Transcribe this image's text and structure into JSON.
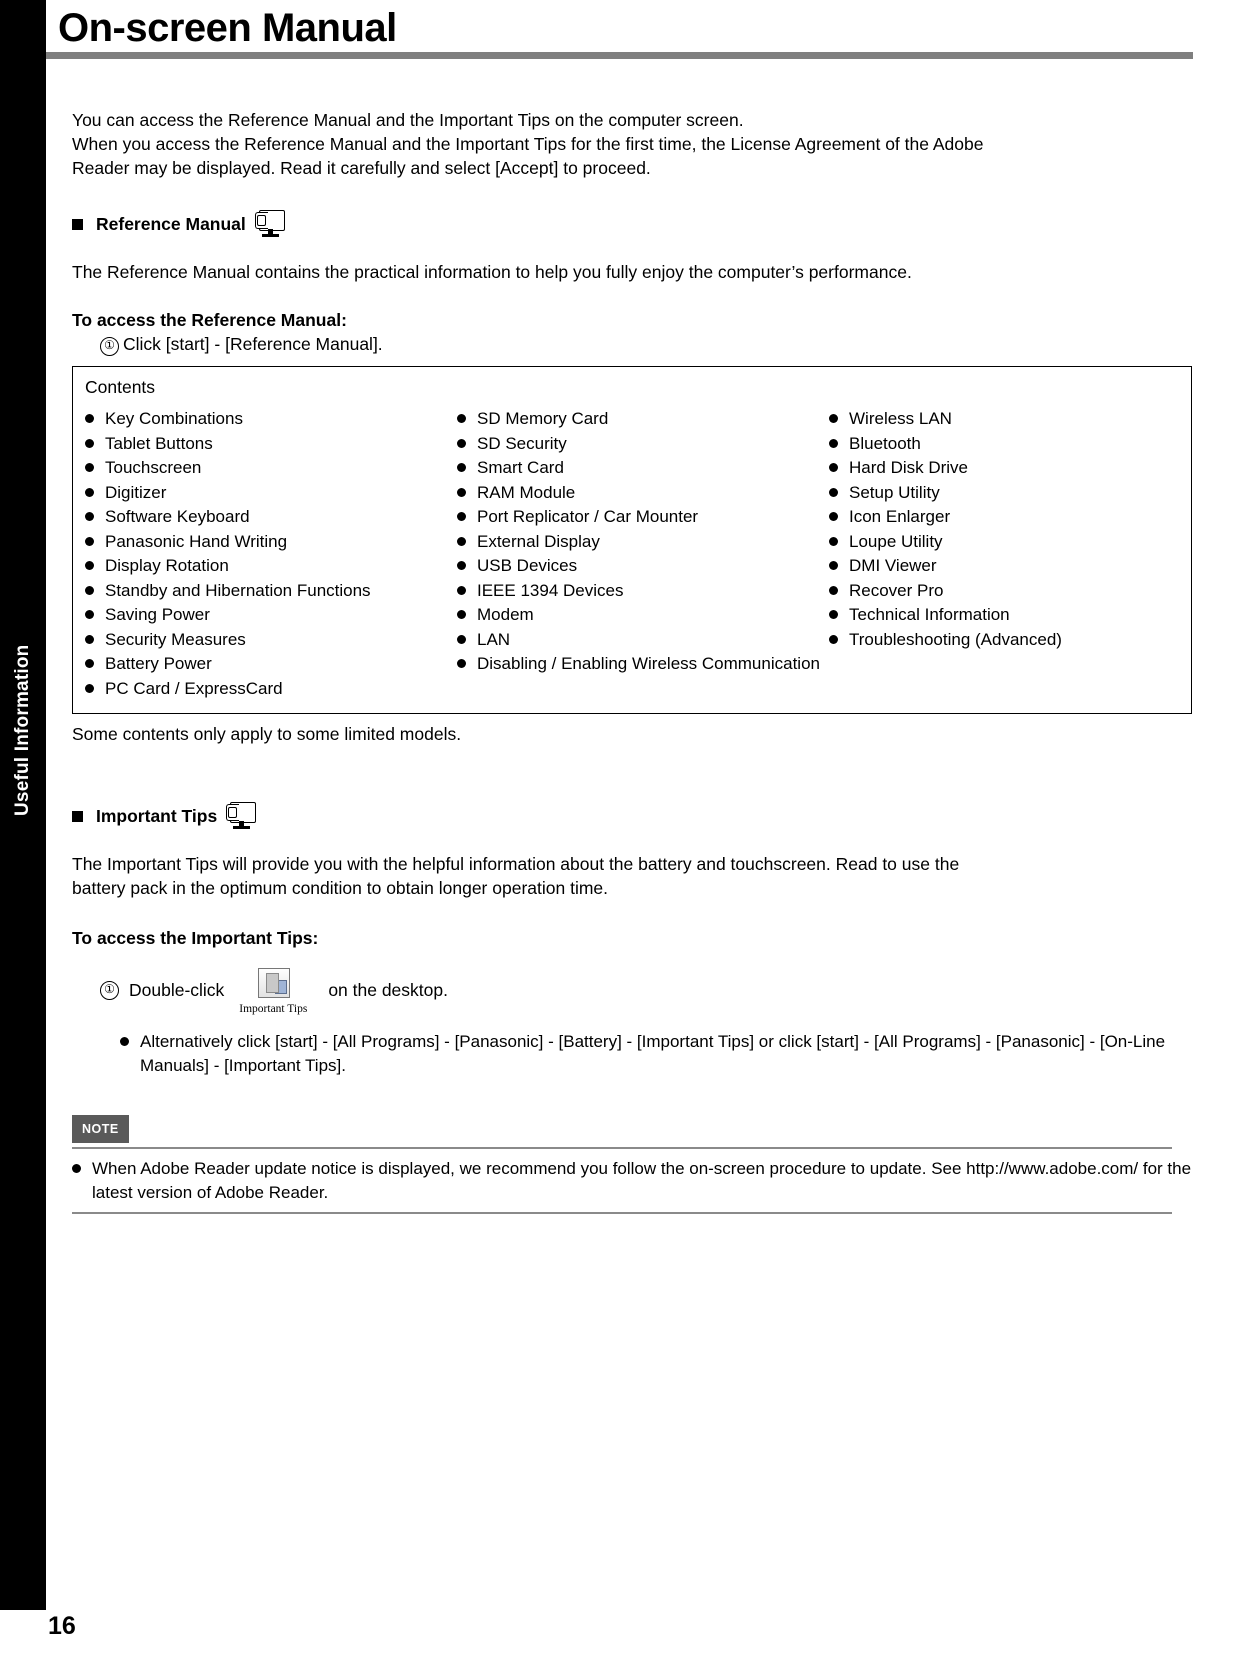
{
  "page": {
    "title": "On-screen Manual",
    "number": "16",
    "side_tab": "Useful Information"
  },
  "intro": {
    "line1": "You can access the Reference Manual and the Important Tips on the computer screen.",
    "line2": "When you access the Reference Manual and the Important Tips for the first time, the License Agreement of the Adobe",
    "line3": "Reader may be displayed. Read it carefully and select [Accept] to proceed."
  },
  "reference_manual": {
    "heading": "Reference Manual",
    "icon": "screen-with-pen-icon",
    "description": "The Reference Manual contains the practical information to help you fully enjoy the computer’s performance.",
    "access_heading": "To access the Reference Manual:",
    "step1_num": "①",
    "step1": "Click [start] - [Reference Manual].",
    "contents_label": "Contents",
    "contents_col1": [
      "Key Combinations",
      "Tablet Buttons",
      "Touchscreen",
      "Digitizer",
      "Software Keyboard",
      "Panasonic Hand Writing",
      "Display Rotation",
      "Standby and Hibernation Functions",
      "Saving Power",
      "Security Measures",
      "Battery Power",
      "PC Card / ExpressCard"
    ],
    "contents_col2": [
      "SD Memory Card",
      "SD Security",
      "Smart Card",
      "RAM Module",
      "Port Replicator / Car Mounter",
      "External Display",
      "USB Devices",
      "IEEE 1394 Devices",
      "Modem",
      "LAN",
      "Disabling / Enabling Wireless Communication"
    ],
    "contents_col3": [
      "Wireless LAN",
      "Bluetooth",
      "Hard Disk Drive",
      "Setup Utility",
      "Icon Enlarger",
      "Loupe Utility",
      "DMI Viewer",
      "Recover Pro",
      "Technical Information",
      "Troubleshooting (Advanced)"
    ],
    "footnote": "Some contents only apply to some limited models."
  },
  "important_tips": {
    "heading": "Important Tips",
    "icon": "screen-with-pen-icon",
    "description_line1": "The Important Tips will provide you with the helpful information about the battery and touchscreen. Read to use the",
    "description_line2": "battery pack in the optimum condition to obtain longer operation time.",
    "access_heading": "To access the Important Tips:",
    "step1_num": "①",
    "step1_before": "Double-click",
    "step1_after": "on the desktop.",
    "desktop_icon_caption": "Important Tips",
    "alt_line1": "Alternatively click [start] - [All Programs] - [Panasonic] - [Battery] - [Important Tips] or click [start] -",
    "alt_line2": "[All Programs] - [Panasonic] - [On-Line Manuals] - [Important Tips]."
  },
  "note": {
    "tag": "NOTE",
    "line1": "When Adobe Reader update notice is displayed, we recommend you follow the on-screen procedure to update.",
    "line2": "See http://www.adobe.com/ for the latest version of Adobe Reader."
  }
}
